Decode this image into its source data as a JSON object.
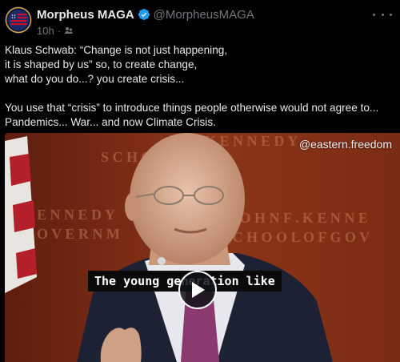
{
  "author": {
    "display_name": "Morpheus MAGA",
    "handle": "@MorpheusMAGA",
    "time": "10h",
    "dot": "·",
    "verified": true
  },
  "post": {
    "lines": [
      "Klaus Schwab: “Change is not just happening,",
      "it is shaped by us” so, to create change,",
      "what do you do...? you create crisis...",
      "You use that “crisis” to introduce things people otherwise would not agree to...",
      "Pandemics... War... and now Climate Crisis."
    ]
  },
  "media": {
    "watermark": "@eastern.freedom",
    "subtitle": "The young generation like",
    "play_icon": "play-icon"
  },
  "colors": {
    "background": "#000000",
    "text": "#e7e9ea",
    "muted": "#71767b",
    "verified": "#1d9bf0"
  }
}
